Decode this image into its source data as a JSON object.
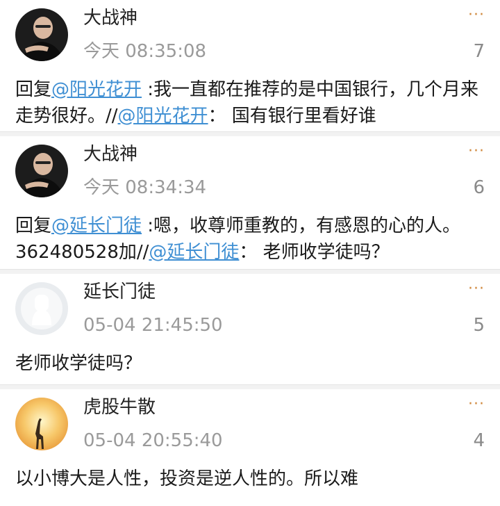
{
  "colors": {
    "link": "#3f8fd3",
    "more_icon": "#d0893f",
    "muted": "#9a9a9a",
    "separator": "#f2f2f2"
  },
  "comments": [
    {
      "avatar": "man-portrait-avatar",
      "name": "大战神",
      "time": "今天 08:35:08",
      "count": "7",
      "more_label": "···",
      "body": {
        "prefix": "回复",
        "mention1": "@阳光花开",
        "text1": " :我一直都在推荐的是中国银行，几个月来走势很好。//",
        "mention2": "@阳光花开",
        "text2": "： 国有银行里看好谁"
      }
    },
    {
      "avatar": "man-portrait-avatar",
      "name": "大战神",
      "time": "今天 08:34:34",
      "count": "6",
      "more_label": "···",
      "body": {
        "prefix": "回复",
        "mention1": "@延长门徒",
        "text1": " :嗯，收尊师重教的，有感恩的心的人。362480528加//",
        "mention2": "@延长门徒",
        "text2": "： 老师收学徒吗？"
      }
    },
    {
      "avatar": "default-avatar",
      "name": "延长门徒",
      "time": "05-04 21:45:50",
      "count": "5",
      "more_label": "···",
      "body": {
        "text": "老师收学徒吗？"
      }
    },
    {
      "avatar": "giraffe-sunset-avatar",
      "name": "虎股牛散",
      "time": "05-04 20:55:40",
      "count": "4",
      "more_label": "···",
      "body": {
        "text": "以小博大是人性，投资是逆人性的。所以难"
      }
    }
  ]
}
